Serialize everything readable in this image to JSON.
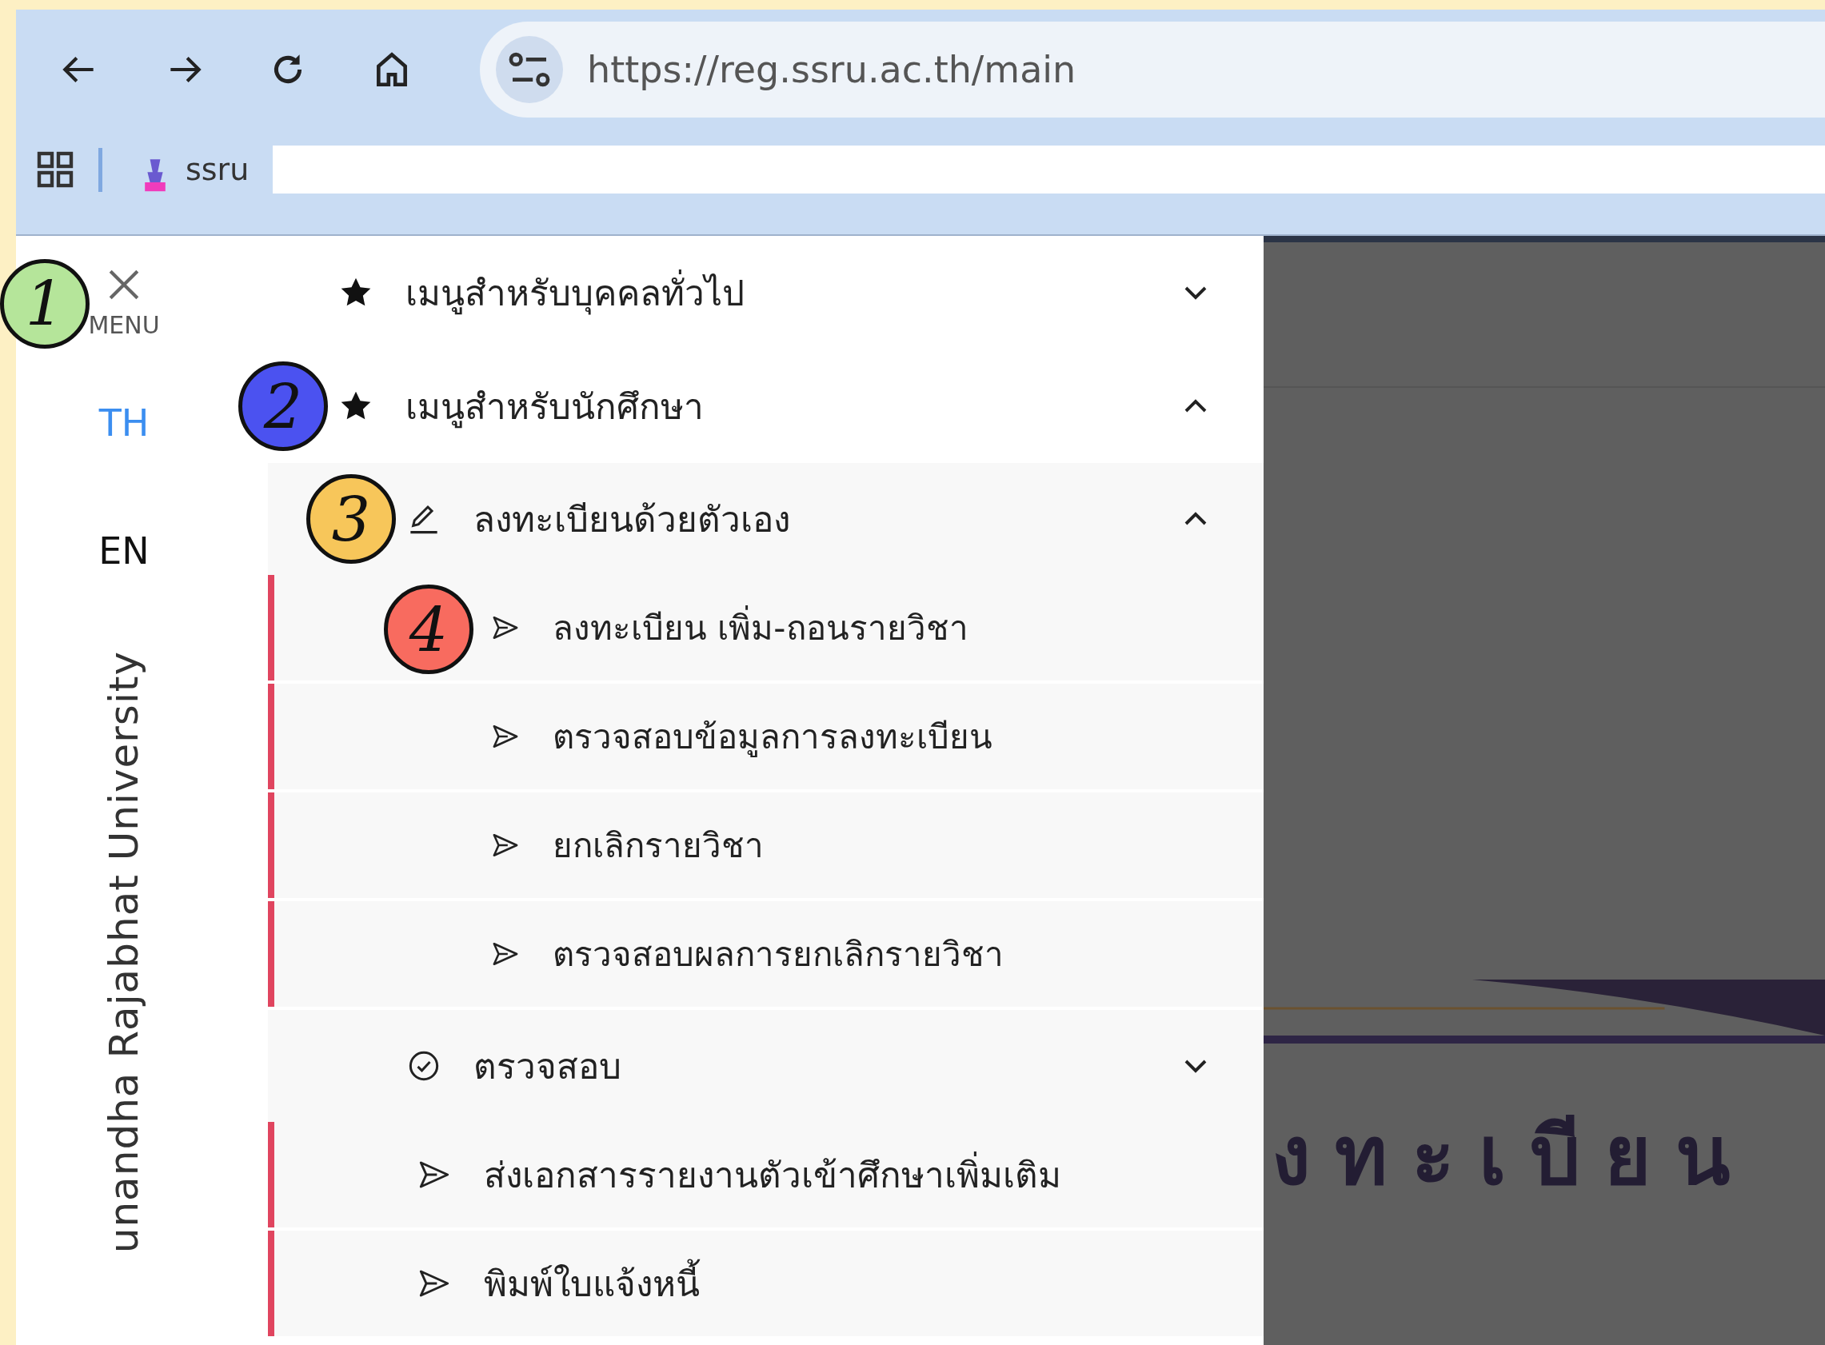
{
  "browser": {
    "url": "https://reg.ssru.ac.th/main",
    "bookmarks": [
      {
        "label": "ssru"
      }
    ]
  },
  "sidebar": {
    "close_label": "MENU",
    "close_marker": {
      "label": "1",
      "color": "#b5e59a"
    },
    "languages": [
      {
        "label": "TH",
        "selected": true
      },
      {
        "label": "EN",
        "selected": false
      }
    ],
    "university": "unandha Rajabhat University"
  },
  "menu": [
    {
      "kind": "section",
      "label": "เมนูสำหรับบุคคลทั่วไป",
      "expanded": false
    },
    {
      "kind": "section",
      "label": "เมนูสำหรับนักศึกษา",
      "expanded": true,
      "marker": {
        "label": "2",
        "color": "#4b52f0"
      },
      "children": [
        {
          "kind": "edit",
          "label": "ลงทะเบียนด้วยตัวเอง",
          "expanded": true,
          "marker": {
            "label": "3",
            "color": "#f7c65a"
          },
          "children": [
            {
              "kind": "link",
              "label": "ลงทะเบียน เพิ่ม-ถอนรายวิชา",
              "marker": {
                "label": "4",
                "color": "#f86b5f"
              }
            },
            {
              "kind": "link",
              "label": "ตรวจสอบข้อมูลการลงทะเบียน"
            },
            {
              "kind": "link",
              "label": "ยกเลิกรายวิชา"
            },
            {
              "kind": "link",
              "label": "ตรวจสอบผลการยกเลิกรายวิชา"
            }
          ]
        },
        {
          "kind": "check",
          "label": "ตรวจสอบ",
          "expanded": false
        },
        {
          "kind": "link",
          "label": "ส่งเอกสารรายงานตัวเข้าศึกษาเพิ่มเติม"
        },
        {
          "kind": "link",
          "label": "พิมพ์ใบแจ้งหนี้"
        }
      ]
    }
  ],
  "background_page": {
    "heading": "งทะเบียน"
  }
}
